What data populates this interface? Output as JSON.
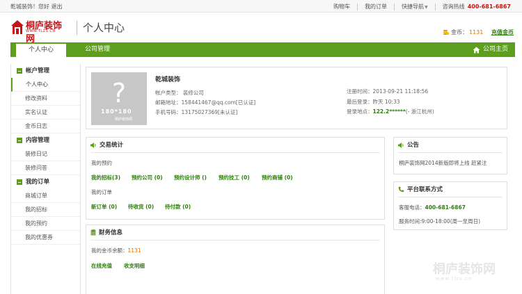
{
  "topbar": {
    "greeting": "乾城装饰！您好 退出",
    "links": [
      "购物车",
      "我的订单",
      "快捷导航"
    ],
    "hotline_label": "咨询热线",
    "hotline_number": "400-681-6867"
  },
  "header": {
    "logo_text": "桐庐装饰网",
    "logo_url": "WWW.TLZS.CN",
    "page_title": "个人中心",
    "coins_label": "金币：",
    "coins_value": "1131",
    "recharge_label": "充值金币"
  },
  "nav": {
    "tabs": [
      "个人中心",
      "公司管理"
    ],
    "home_label": "公司主页"
  },
  "sidebar": {
    "sections": [
      {
        "title": "帐户管理",
        "items": [
          "个人中心",
          "修改资料",
          "实名认证",
          "金币日志"
        ]
      },
      {
        "title": "内容管理",
        "items": [
          "装修日记",
          "装修问答"
        ]
      },
      {
        "title": "我的订单",
        "items": [
          "商城订单",
          "我的招标",
          "我的预约",
          "我的优惠券"
        ]
      }
    ]
  },
  "profile": {
    "avatar_size": "180*180",
    "avatar_mark": "桐庐装饰网",
    "name": "乾城装饰",
    "account_type": "帐户类型： 装修公司",
    "email": "邮箱地址：158441467@qq.com[已认证]",
    "phone": "手机号码：13175027369[未认证]",
    "register_time": "注册时间：2013-09-21 11:18:56",
    "last_login": "最后登录：昨天 10:33",
    "login_place_label": "登录地点：",
    "login_ip": "122.2******",
    "login_city": "(- 浙江杭州)"
  },
  "trade": {
    "title": "交易统计",
    "booking_label": "我的预约",
    "booking_links": [
      "我的招标(3)",
      "预约公司 (0)",
      "预约设计师 ()",
      "预约技工 (0)",
      "预约商铺 (0)"
    ],
    "orders_label": "我的订单",
    "order_links": [
      "新订单 (0)",
      "待收货 (0)",
      "待付款 (0)"
    ]
  },
  "finance": {
    "title": "财务信息",
    "balance_label": "我的金币余额：",
    "balance_value": "1131",
    "links": [
      "在线充值",
      "收支明细"
    ]
  },
  "notice": {
    "title": "公告",
    "text": "桐庐装饰网2014新版即将上线 赶紧注"
  },
  "contact": {
    "title": "平台联系方式",
    "phone_label": "客服电话：",
    "phone_value": "400-681-6867",
    "hours": "服务时间:9:00-18:00(周一至周日)"
  },
  "watermark": {
    "text": "桐庐装饰网",
    "url": "www.tlzs.cn"
  },
  "colors": {
    "brand_green": "#5d9e1e",
    "link_green": "#2f7f0f",
    "brand_red": "#c0141b",
    "coin_orange": "#e07000"
  }
}
